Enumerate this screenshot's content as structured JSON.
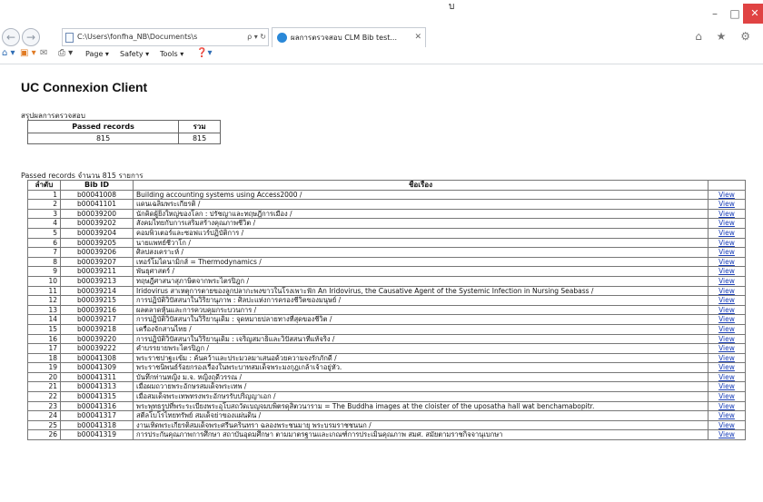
{
  "window": {
    "title_mark": "บ",
    "controls": {
      "minimize": "–",
      "maximize": "□",
      "close": "✕"
    }
  },
  "navigation": {
    "back_icon": "back-arrow-icon",
    "forward_icon": "forward-arrow-icon",
    "address": "C:\\Users\\fonfha_NB\\Documents\\s",
    "address_tools": "ρ ▾ ↻",
    "tab_title": "ผลการตรวจสอบ CLM Bib test...",
    "tab_close": "✕",
    "right_icons": "⌂ ★ ⚙"
  },
  "command_bar": {
    "home": "⌂ ▾",
    "feeds": "▣ ▾",
    "mail": "✉",
    "print": "⎙ ▾",
    "page": "Page ▾",
    "safety": "Safety ▾",
    "tools": "Tools ▾",
    "help": "❓▾"
  },
  "page": {
    "title": "UC Connexion Client",
    "summary_label": "สรุปผลการตรวจสอบ",
    "summary_headers": [
      "Passed records",
      "รวม"
    ],
    "summary_values": [
      "815",
      "815"
    ],
    "list_label": "Passed records จำนวน 815 รายการ",
    "table_headers": [
      "ลำดับ",
      "Bib ID",
      "ชื่อเรื่อง",
      ""
    ]
  },
  "records": [
    {
      "no": "1",
      "bib": "b00041008",
      "title": "Building accounting systems using Access2000 /",
      "view": "View"
    },
    {
      "no": "2",
      "bib": "b00041101",
      "title": "แดนเฉลิมพระเกียรติ /",
      "view": "View"
    },
    {
      "no": "3",
      "bib": "b00039200",
      "title": "นักคิดผู้ยิ่งใหญ่ของโลก : ปรัชญาและทฤษฎีการเมือง /",
      "view": "View"
    },
    {
      "no": "4",
      "bib": "b00039202",
      "title": "สังคมไทยกับการเสริมสร้างคุณภาพชีวิต /",
      "view": "View"
    },
    {
      "no": "5",
      "bib": "b00039204",
      "title": "คอมพิวเตอร์และซอฟแวร์ปฏิบัติการ /",
      "view": "View"
    },
    {
      "no": "6",
      "bib": "b00039205",
      "title": "นายแพทย์ชีวาโก /",
      "view": "View"
    },
    {
      "no": "7",
      "bib": "b00039206",
      "title": "ศิลปสงเคราะห์ /",
      "view": "View"
    },
    {
      "no": "8",
      "bib": "b00039207",
      "title": "เทอร์โมไดนามิกส์ = Thermodynamics /",
      "view": "View"
    },
    {
      "no": "9",
      "bib": "b00039211",
      "title": "พันธุศาสตร์ /",
      "view": "View"
    },
    {
      "no": "10",
      "bib": "b00039213",
      "title": "ทฤษฎีศาสนาสุภาษิตจากพระไตรปิฎก /",
      "view": "View"
    },
    {
      "no": "11",
      "bib": "b00039214",
      "title": "Iridovirus สาเหตุการตายของลูกปลากะพงขาวในโรงเพาะฟัก An Iridovirus, the Causative Agent of the Systemic Infection in Nursing Seabass /",
      "view": "View"
    },
    {
      "no": "12",
      "bib": "b00039215",
      "title": "การปฏิบัติวิปัสสนาในวิริยานุภาพ : ศิลปะแห่งการครองชีวิตของมนุษย์ /",
      "view": "View"
    },
    {
      "no": "13",
      "bib": "b00039216",
      "title": "ผลตลาดหุ้นและการควบคุมกระบวนการ /",
      "view": "View"
    },
    {
      "no": "14",
      "bib": "b00039217",
      "title": "การปฏิบัติวิปัสสนาในวิริยานุเดิม : จุดหมายปลายทางที่สุดของชีวิต /",
      "view": "View"
    },
    {
      "no": "15",
      "bib": "b00039218",
      "title": "เครื่องจักสานไทย /",
      "view": "View"
    },
    {
      "no": "16",
      "bib": "b00039220",
      "title": "การปฏิบัติวิปัสสนาในวิริยานุเดิม : เจริญสมาธิและวิปัสสนาที่แท้จริง /",
      "view": "View"
    },
    {
      "no": "17",
      "bib": "b00039222",
      "title": "คำบรรยายพระไตรปิฎก /",
      "view": "View"
    },
    {
      "no": "18",
      "bib": "b00041308",
      "title": "พระราชปาฐะเข้ม : ค้นคว้าและประมวลมาเสนอด้วยความจงรักภักดี /",
      "view": "View"
    },
    {
      "no": "19",
      "bib": "b00041309",
      "title": "พระราชนิพนธ์ร้อยกรองเรื่องในพระบาทสมเด็จพระมงกุฎเกล้าเจ้าอยู่หัว.",
      "view": "View"
    },
    {
      "no": "20",
      "bib": "b00041311",
      "title": "บันทึกท่านหญิง ม.จ. หญิงฤดีวรรณ /",
      "view": "View"
    },
    {
      "no": "21",
      "bib": "b00041313",
      "title": "เมื่อผมถวายพระอักษรสมเด็จพระเทพ /",
      "view": "View"
    },
    {
      "no": "22",
      "bib": "b00041315",
      "title": "เมื่อสมเด็จพระเทพทรงพระอักษรรับปริญญาเอก /",
      "view": "View"
    },
    {
      "no": "23",
      "bib": "b00041316",
      "title": "พระพุทธรูปที่พระระเบียงพระอุโบสถวัดเบญจมบพิตรดุสิตวนาราม = The Buddha images at the cloister of the uposatha hall wat benchamabopitr.",
      "view": "View"
    },
    {
      "no": "24",
      "bib": "b00041317",
      "title": "สตีลโบโรไทยทรัพย์ สมเด็จย่าของแผ่นดิน /",
      "view": "View"
    },
    {
      "no": "25",
      "bib": "b00041318",
      "title": "งานเทิดพระเกียรติสมเด็จพระศรีนครินทรา ฉลองพระชนมายุ พระบรมราชชนนก /",
      "view": "View"
    },
    {
      "no": "26",
      "bib": "b00041319",
      "title": "การประกันคุณภาพการศึกษา สถาบันอุดมศึกษา ตามมาตรฐานและเกณฑ์การประเมินคุณภาพ สมศ. สมัยตามราชกิจจานุเบกษา",
      "view": "View"
    }
  ]
}
